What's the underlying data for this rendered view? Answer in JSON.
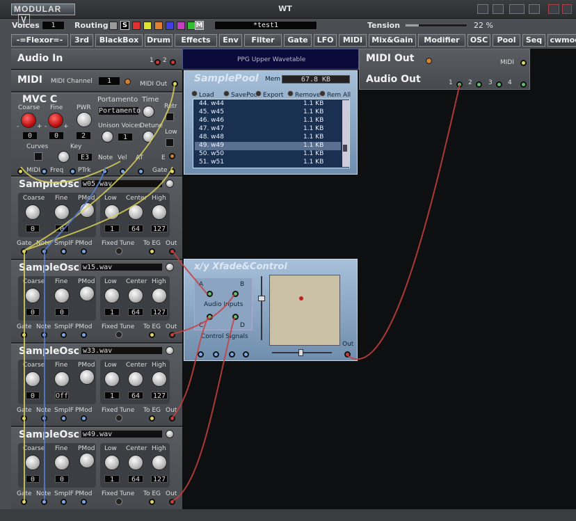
{
  "window": {
    "title": "WT",
    "logo": "MODULAR",
    "logo_badge": "V"
  },
  "toolbar": {
    "voices_label": "Voices",
    "voices_value": "1",
    "routing_label": "Routing",
    "routing_s": "S",
    "routing_m": "M",
    "patch_name": "*test1",
    "tension_label": "Tension",
    "tension_value": "22 %",
    "tension_fraction": 0.22,
    "routing_colors": [
      "#9a9a9a",
      "#e03030",
      "#e0e030",
      "#e08030",
      "#4040e0",
      "#c040c0",
      "#30c030",
      "#9a9a9a"
    ]
  },
  "categories": [
    "-=Flexor=-",
    "3rd",
    "BlackBox",
    "Drum",
    "Effects",
    "Env",
    "Filter",
    "Gate",
    "LFO",
    "MIDI",
    "Mix&Gain",
    "Modifier",
    "OSC",
    "Pool",
    "Seq",
    "cwmodular"
  ],
  "audio_in": {
    "title": "Audio In",
    "p1": "1",
    "p2": "2"
  },
  "midi": {
    "title": "MIDI",
    "channel_label": "MIDI Channel",
    "channel": "1",
    "out_label": "MIDI Out"
  },
  "mvc": {
    "title": "MVC C",
    "coarse": "Coarse",
    "fine": "Fine",
    "pwr": "PWR",
    "coarse_val": "0",
    "fine_val": "0",
    "pwr_val": "2",
    "portamento": "Portamento",
    "portamento_val": "Portamento",
    "time": "Time",
    "retr": "Retr",
    "unison": "Unison Voices",
    "unison_val": "1",
    "detune": "Detune",
    "low": "Low",
    "curves": "Curves",
    "key": "Key",
    "key_val": "E3",
    "note": "Note",
    "vel": "Vel",
    "at": "AT",
    "e": "E",
    "midi": "MIDI",
    "freq": "Freq",
    "ptrk": "PTrk",
    "gate": "Gate",
    "minus": "-",
    "plus": "+"
  },
  "osc_labels": {
    "coarse": "Coarse",
    "fine": "Fine",
    "pmod": "PMod",
    "low": "Low",
    "center": "Center",
    "high": "High",
    "gate": "Gate",
    "note": "Note",
    "smplf": "SmplF",
    "fixed": "Fixed Tune",
    "to_eg": "To EG",
    "out": "Out",
    "title": "SampleOsc"
  },
  "oscs": [
    {
      "file": "w05.wav",
      "coarse": "0",
      "fine": "0",
      "low": "1",
      "center": "64",
      "high": "127"
    },
    {
      "file": "w15.wav",
      "coarse": "0",
      "fine": "0",
      "low": "1",
      "center": "64",
      "high": "127"
    },
    {
      "file": "w33.wav",
      "coarse": "0",
      "fine": "Off",
      "low": "1",
      "center": "64",
      "high": "127"
    },
    {
      "file": "w49.wav",
      "coarse": "0",
      "fine": "0",
      "low": "1",
      "center": "64",
      "high": "127"
    }
  ],
  "ppg": {
    "title": "PPG Upper Wavetable"
  },
  "samplepool": {
    "title": "SamplePool",
    "mem_label": "Mem",
    "mem": "67.8 KB",
    "buttons": [
      "Load",
      "SavePool",
      "Export",
      "Remove",
      "Rem All"
    ],
    "rows": [
      {
        "n": "44. w44",
        "s": "1.1 KB"
      },
      {
        "n": "45. w45",
        "s": "1.1 KB"
      },
      {
        "n": "46. w46",
        "s": "1.1 KB"
      },
      {
        "n": "47. w47",
        "s": "1.1 KB"
      },
      {
        "n": "48. w48",
        "s": "1.1 KB"
      },
      {
        "n": "49. w49",
        "s": "1.1 KB"
      },
      {
        "n": "50. w50",
        "s": "1.1 KB"
      },
      {
        "n": "51. w51",
        "s": "1.1 KB"
      }
    ]
  },
  "midi_out": {
    "title": "MIDI Out",
    "port": "MIDI"
  },
  "audio_out": {
    "title": "Audio Out",
    "p1": "1",
    "p2": "2",
    "p3": "3",
    "p4": "4"
  },
  "xy": {
    "title": "x/y Xfade&Control",
    "a": "A",
    "b": "B",
    "c": "C",
    "d": "D",
    "audio_inputs": "Audio Inputs",
    "control_signals": "Control Signals",
    "out": "Out"
  }
}
